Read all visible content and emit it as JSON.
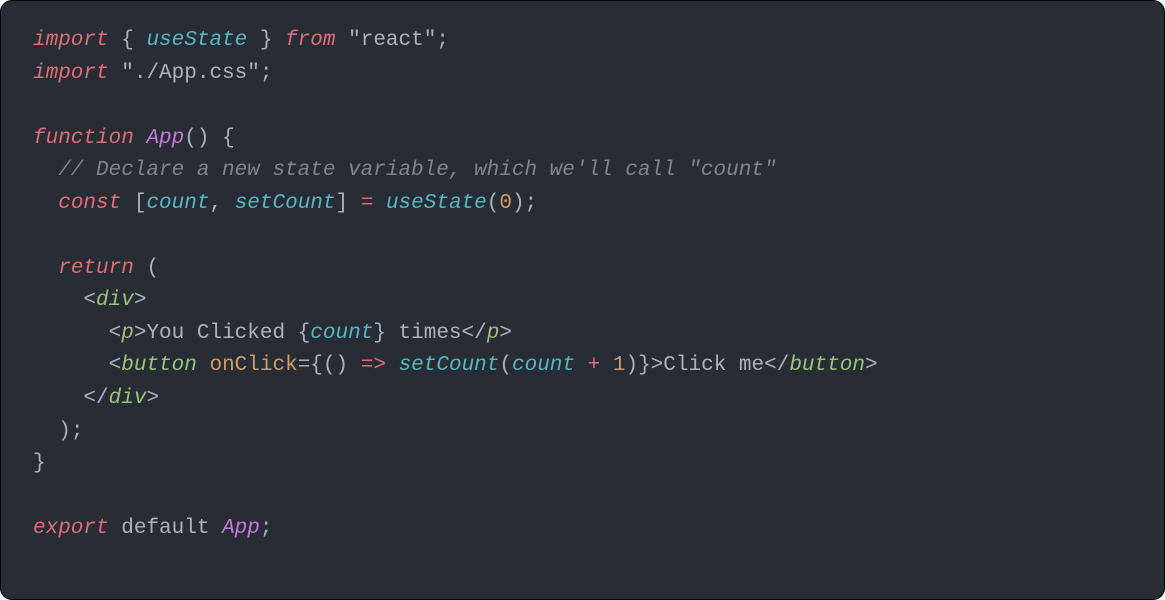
{
  "code": {
    "line1": {
      "import": "import",
      "lbrace": " { ",
      "hook": "useState",
      "rbrace": " } ",
      "from": "from",
      "space": " ",
      "str": "\"react\"",
      "semi": ";"
    },
    "line2": {
      "import": "import",
      "space": " ",
      "str": "\"./App.css\"",
      "semi": ";"
    },
    "line4": {
      "function": "function",
      "space": " ",
      "name": "App",
      "parens": "()",
      "space2": " ",
      "brace": "{"
    },
    "line5": {
      "comment": "  // Declare a new state variable, which we'll call \"count\""
    },
    "line6": {
      "indent": "  ",
      "const": "const",
      "space": " ",
      "lbracket": "[",
      "count": "count",
      "comma": ", ",
      "setCount": "setCount",
      "rbracket": "]",
      "space2": " ",
      "assign": "=",
      "space3": " ",
      "useState": "useState",
      "lparen": "(",
      "zero": "0",
      "rparen": ")",
      "semi": ";"
    },
    "line8": {
      "indent": "  ",
      "return": "return",
      "space": " ",
      "lparen": "("
    },
    "line9": {
      "indent": "    ",
      "lt": "<",
      "tag": "div",
      "gt": ">"
    },
    "line10": {
      "indent": "      ",
      "lt": "<",
      "tag": "p",
      "gt": ">",
      "text1": "You Clicked ",
      "lbrace": "{",
      "count": "count",
      "rbrace": "}",
      "text2": " times",
      "lt2": "</",
      "tag2": "p",
      "gt2": ">"
    },
    "line11": {
      "indent": "      ",
      "lt": "<",
      "tag": "button",
      "space": " ",
      "attr": "onClick",
      "eq": "=",
      "lbrace": "{",
      "lparen": "()",
      "space2": " ",
      "arrow": "=>",
      "space3": " ",
      "setCount": "setCount",
      "lparen2": "(",
      "count": "count",
      "space4": " ",
      "plus": "+",
      "space5": " ",
      "one": "1",
      "rparen2": ")",
      "rbrace": "}",
      "gt": ">",
      "text": "Click me",
      "lt2": "</",
      "tag2": "button",
      "gt2": ">"
    },
    "line12": {
      "indent": "    ",
      "lt": "</",
      "tag": "div",
      "gt": ">"
    },
    "line13": {
      "indent": "  ",
      "rparen": ")",
      "semi": ";"
    },
    "line14": {
      "brace": "}"
    },
    "line16": {
      "export": "export",
      "space": " ",
      "default": "default",
      "space2": " ",
      "name": "App",
      "semi": ";"
    }
  }
}
